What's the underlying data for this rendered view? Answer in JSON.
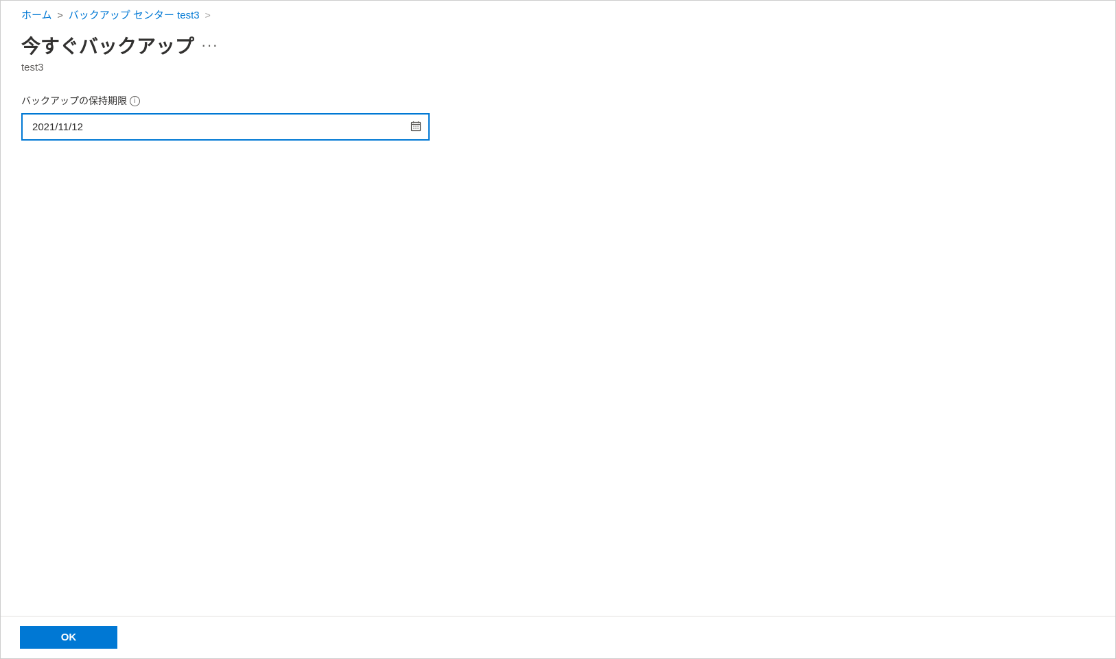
{
  "breadcrumb": {
    "home": "ホーム",
    "backup_center": "バックアップ センター",
    "item": "test3"
  },
  "header": {
    "title": "今すぐバックアップ",
    "subtitle": "test3"
  },
  "form": {
    "retention_label": "バックアップの保持期限",
    "retention_value": "2021/11/12"
  },
  "footer": {
    "ok_label": "OK"
  }
}
